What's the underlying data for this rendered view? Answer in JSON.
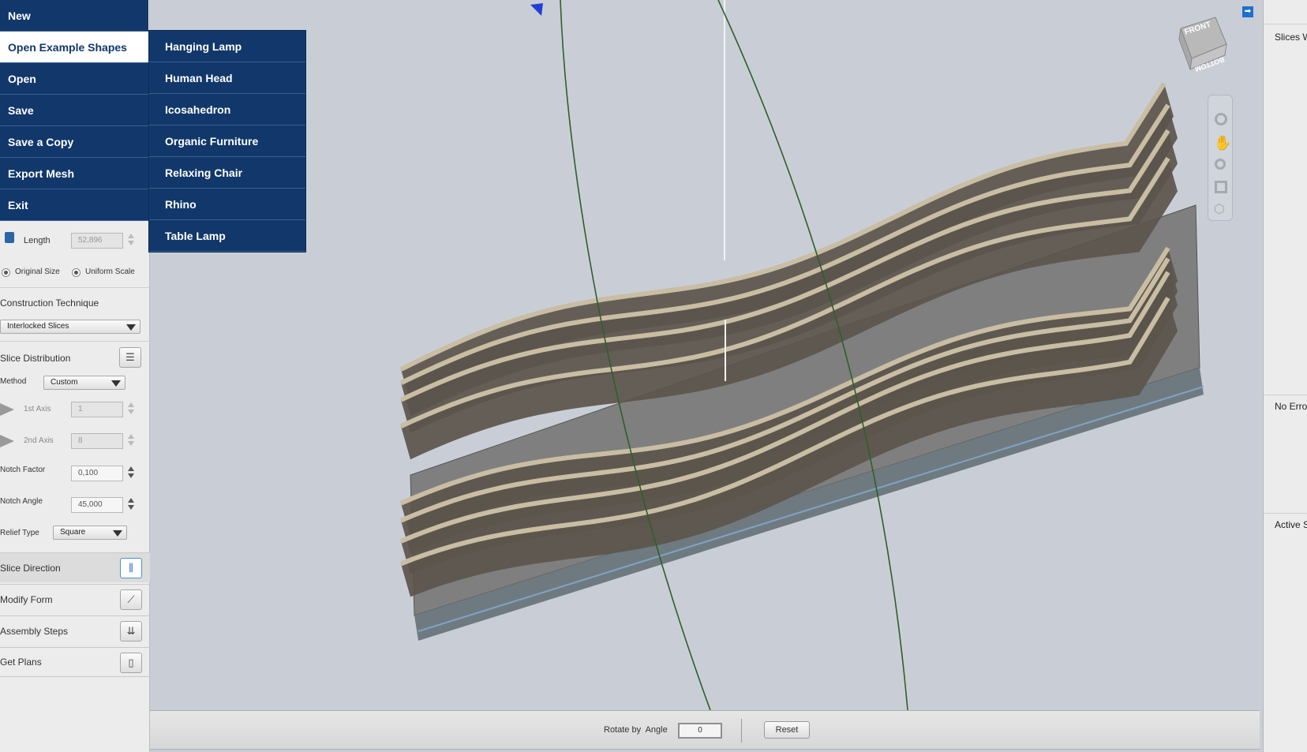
{
  "file_menu": {
    "items": [
      "New",
      "Open Example Shapes",
      "Open",
      "Save",
      "Save a Copy",
      "Export Mesh",
      "Exit"
    ],
    "selected": "Open Example Shapes"
  },
  "examples_submenu": {
    "items": [
      "Hanging Lamp",
      "Human Head",
      "Icosahedron",
      "Organic Furniture",
      "Relaxing Chair",
      "Rhino",
      "Table Lamp"
    ]
  },
  "left_panel": {
    "length": {
      "label": "Length",
      "value": "52,896"
    },
    "size_options": {
      "original": "Original Size",
      "uniform": "Uniform Scale"
    },
    "construction": {
      "title": "Construction Technique",
      "value": "Interlocked Slices"
    },
    "distribution": {
      "title": "Slice Distribution",
      "method_label": "Method",
      "method_value": "Custom",
      "axis1_label": "1st Axis",
      "axis1_value": "1",
      "axis2_label": "2nd Axis",
      "axis2_value": "8",
      "notch_factor_label": "Notch Factor",
      "notch_factor_value": "0,100",
      "notch_angle_label": "Notch Angle",
      "notch_angle_value": "45,000",
      "relief_label": "Relief Type",
      "relief_value": "Square"
    },
    "sections": [
      "Slice Direction",
      "Modify Form",
      "Assembly Steps",
      "Get Plans"
    ]
  },
  "view_cube": {
    "front": "FRONT",
    "bottom": "BOTTOM"
  },
  "bottom_bar": {
    "rotate_label": "Rotate by  Angle",
    "angle_value": "0",
    "reset_label": "Reset"
  },
  "right_panel": {
    "slices": "Slices W",
    "errors": "No Erro",
    "active": "Active S"
  },
  "colors": {
    "menu_bg": "#12386b",
    "viewport_bg": "#c9ced6",
    "slab": "#5b554c",
    "slice_edge": "#c9bda3"
  }
}
